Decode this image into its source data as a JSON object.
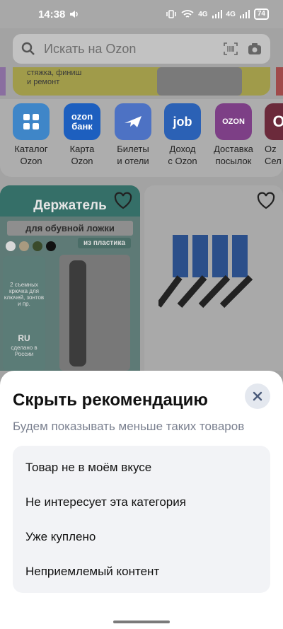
{
  "status": {
    "time": "14:38",
    "network_a": "4G",
    "network_b": "4G",
    "battery": "74"
  },
  "search": {
    "placeholder": "Искать на Ozon"
  },
  "banner": {
    "text_line1": "стяжка, финиш",
    "text_line2": "и ремонт"
  },
  "categories": [
    {
      "label1": "Каталог",
      "label2": "Ozon",
      "tile_color": "#3f86c8",
      "tile_text": ""
    },
    {
      "label1": "Карта",
      "label2": "Ozon",
      "tile_color": "#1d5fbf",
      "tile_text": "ozon банк"
    },
    {
      "label1": "Билеты",
      "label2": "и отели",
      "tile_color": "#4d72c4",
      "tile_text": ""
    },
    {
      "label1": "Доход",
      "label2": "с Ozon",
      "tile_color": "#2b61b5",
      "tile_text": "job"
    },
    {
      "label1": "Доставка",
      "label2": "посылок",
      "tile_color": "#7d3f86",
      "tile_text": "OZON"
    },
    {
      "label1": "Oz",
      "label2": "Сел",
      "tile_color": "#6b2a3b",
      "tile_text": "O"
    }
  ],
  "product1": {
    "heading": "Держатель",
    "subheading": "для обувной ложки",
    "tag": "из пластика",
    "panel_text": "2 съемных крючка для ключей, зонтов и пр.",
    "panel_ru": "RU",
    "panel_made": "сделано в России"
  },
  "sheet": {
    "title": "Скрыть рекомендацию",
    "subtitle": "Будем показывать меньше таких товаров",
    "options": [
      "Товар не в моём вкусе",
      "Не интересует эта категория",
      "Уже куплено",
      "Неприемлемый контент"
    ]
  },
  "colors": {
    "accent": "#005bff",
    "sheet_bg": "#ffffff",
    "option_bg": "#f2f3f6",
    "subtitle": "#7b8190"
  }
}
